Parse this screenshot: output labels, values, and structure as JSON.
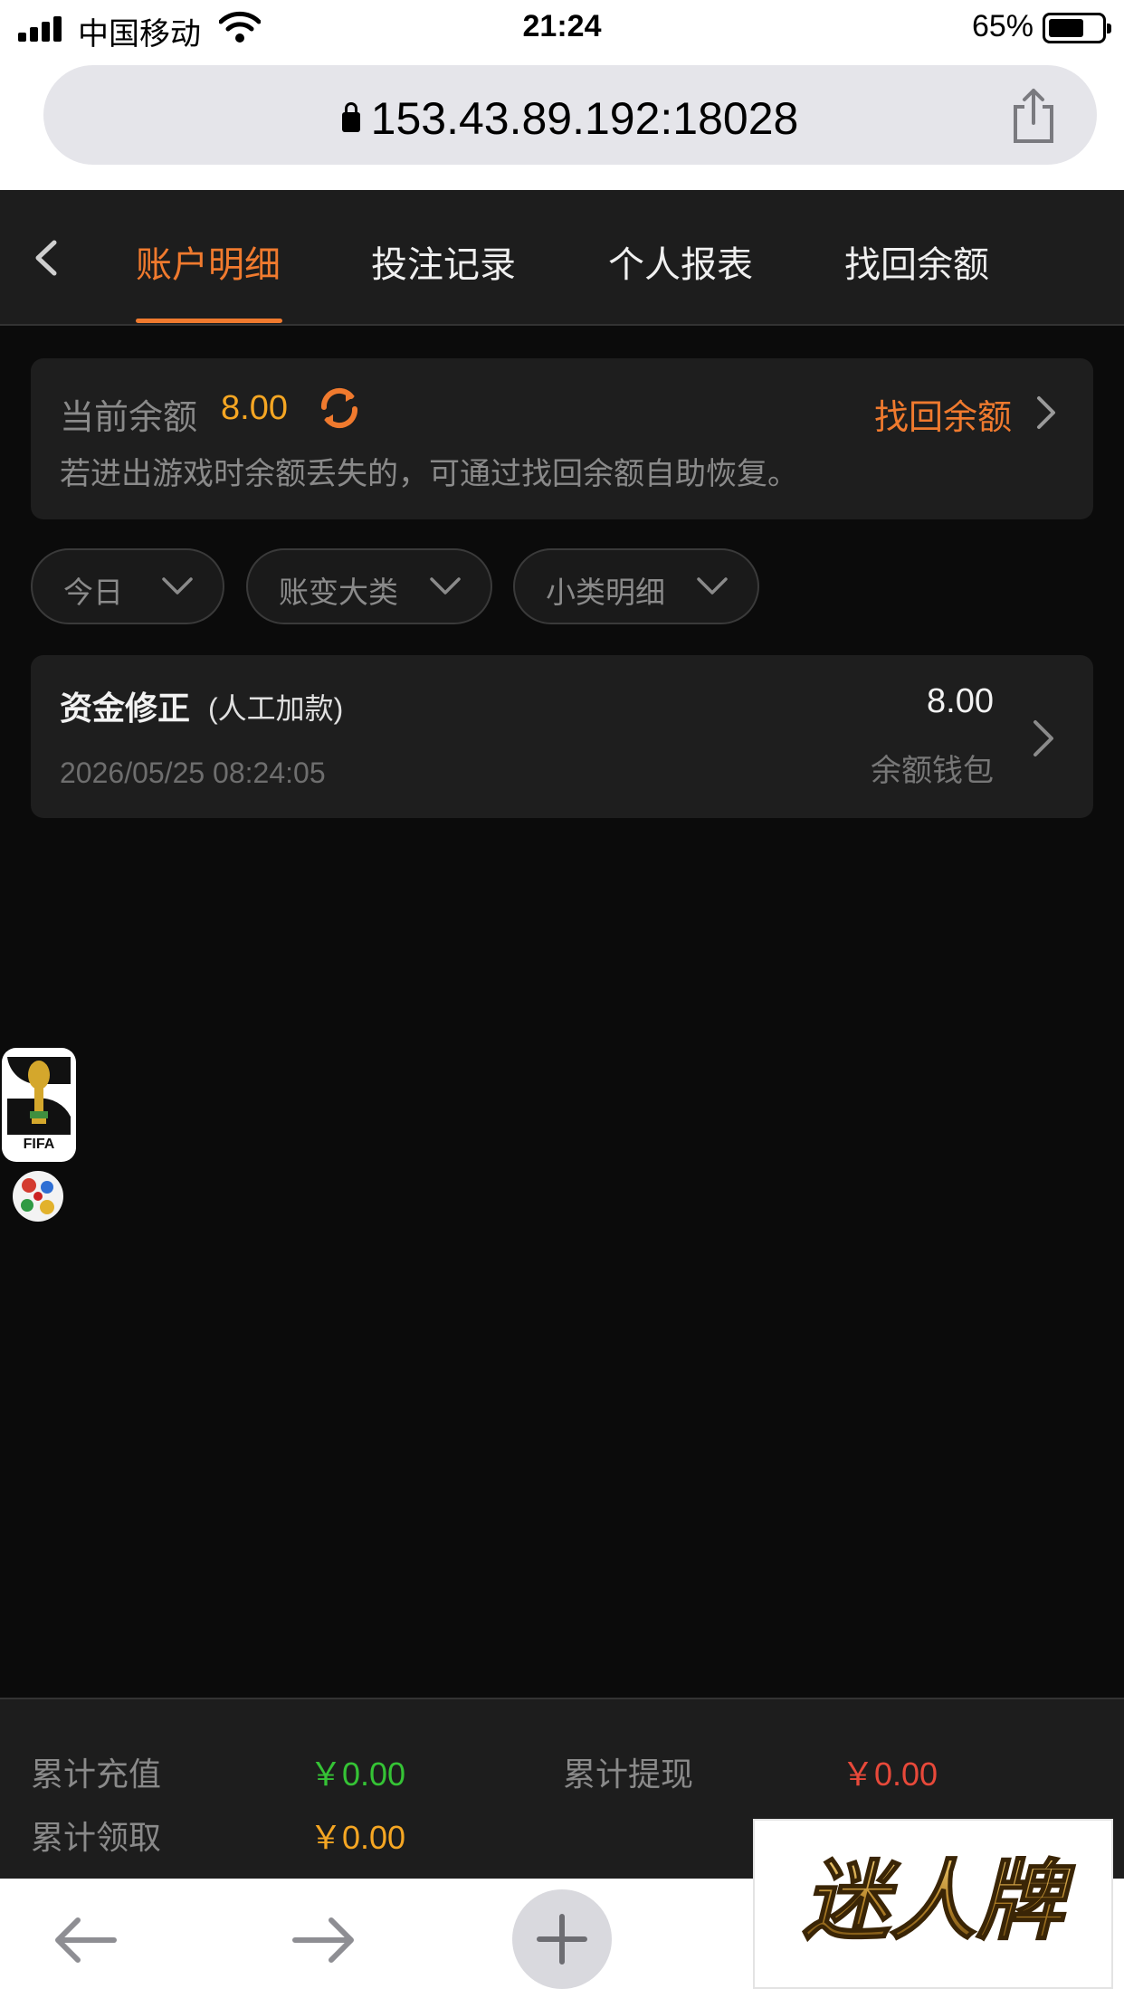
{
  "status_bar": {
    "carrier": "中国移动",
    "time": "21:24",
    "battery": "65%"
  },
  "browser": {
    "url": "153.43.89.192:18028"
  },
  "nav": {
    "tabs": [
      {
        "label": "账户明细"
      },
      {
        "label": "投注记录"
      },
      {
        "label": "个人报表"
      },
      {
        "label": "找回余额"
      }
    ]
  },
  "balance": {
    "label": "当前余额",
    "value": "8.00",
    "recover_label": "找回余额",
    "note": "若进出游戏时余额丢失的，可通过找回余额自助恢复。"
  },
  "filters": [
    {
      "label": "今日"
    },
    {
      "label": "账变大类"
    },
    {
      "label": "小类明细"
    }
  ],
  "records": [
    {
      "title": "资金修正",
      "subtitle": "(人工加款)",
      "time": "2026/05/25 08:24:05",
      "amount": "8.00",
      "wallet": "余额钱包"
    }
  ],
  "side": {
    "fifa_label": "FIFA"
  },
  "summary": {
    "total_deposit_label": "累计充值",
    "total_deposit_value": "￥0.00",
    "total_withdraw_label": "累计提现",
    "total_withdraw_value": "￥0.00",
    "total_claim_label": "累计领取",
    "total_claim_value": "￥0.00"
  },
  "logo": {
    "text": "迷人牌"
  },
  "colors": {
    "accent": "#f07a2e",
    "balance": "#f5a623",
    "deposit": "#35c335",
    "withdraw": "#e8493a",
    "claim": "#f5a623"
  }
}
